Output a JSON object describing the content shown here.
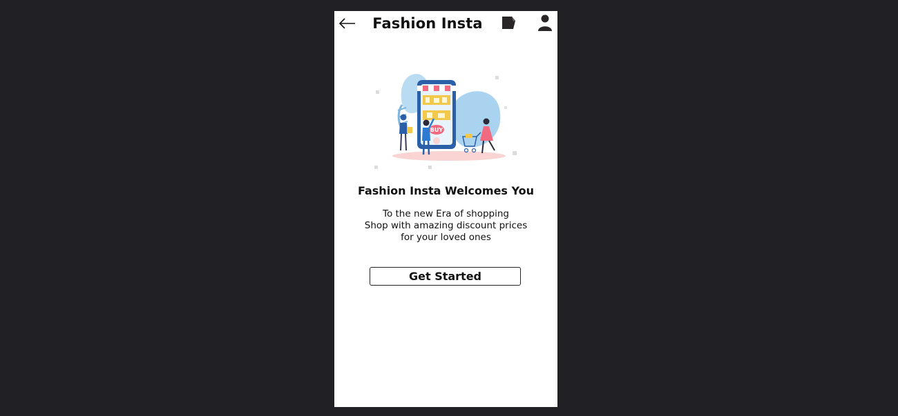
{
  "header": {
    "title": "Fashion Insta",
    "back_icon": "arrow-left-icon",
    "tag_icon": "tag-icon",
    "profile_icon": "user-icon"
  },
  "hero": {
    "image_icon": "shopping-illustration",
    "shop_sign": "BUY"
  },
  "welcome": {
    "heading": "Fashion Insta Welcomes You",
    "lines": [
      "To the new Era of shopping",
      "Shop with amazing discount prices",
      "for your loved ones"
    ]
  },
  "cta": {
    "label": "Get Started"
  },
  "colors": {
    "background": "#202025",
    "screen": "#ffffff",
    "text": "#111111",
    "accent_blue": "#a9d3ef",
    "accent_yellow": "#f2c94c",
    "accent_pink": "#f26a7f"
  }
}
